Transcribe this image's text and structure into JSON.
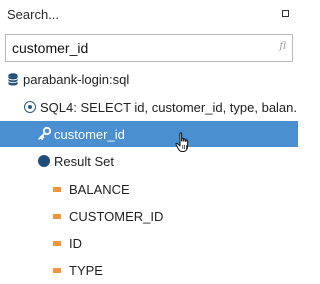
{
  "header": {
    "title": "Search...",
    "maximize_icon": "maximize-icon"
  },
  "search": {
    "value": "customer_id",
    "filter_icon_glyph": "fl"
  },
  "tree": {
    "database": {
      "label": "parabank-login:sql",
      "icon": "database-icon"
    },
    "query": {
      "label": "SQL4: SELECT id, customer_id, type, balan...",
      "icon": "query-icon"
    },
    "match": {
      "label": "customer_id",
      "icon": "key-icon",
      "selected": true
    },
    "result_set": {
      "label": "Result Set",
      "icon": "result-set-icon"
    },
    "columns": [
      {
        "label": "BALANCE",
        "icon": "column-icon"
      },
      {
        "label": "CUSTOMER_ID",
        "icon": "column-icon"
      },
      {
        "label": "ID",
        "icon": "column-icon"
      },
      {
        "label": "TYPE",
        "icon": "column-icon"
      }
    ]
  },
  "colors": {
    "selection": "#4a8fd0",
    "column_icon": "#f5923e",
    "db_icon": "#1f4e7a",
    "query_icon": "#2c5a86"
  }
}
